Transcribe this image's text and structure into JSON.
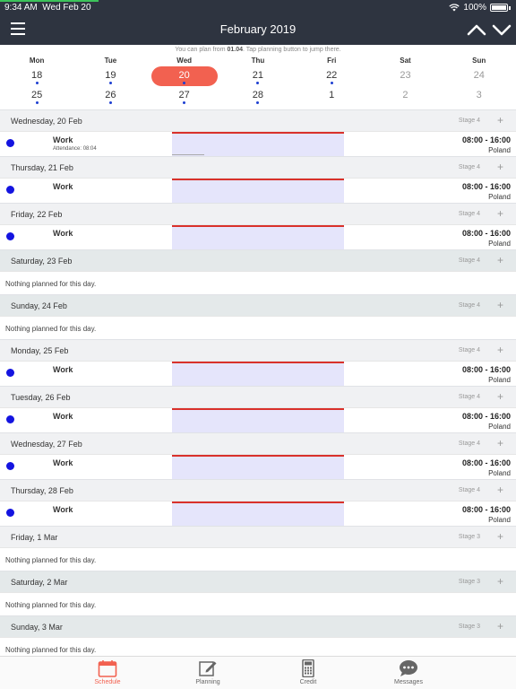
{
  "status_bar": {
    "time": "9:34 AM",
    "date": "Wed Feb 20",
    "battery": "100%"
  },
  "header": {
    "title": "February 2019",
    "menu_icon": "hamburger-icon",
    "prev_icon": "chevron-up-icon",
    "next_icon": "chevron-down-icon"
  },
  "calendar": {
    "hint_prefix": "You can plan from ",
    "hint_date": "01.04",
    "hint_suffix": ". Tap planning button to jump there.",
    "weekdays": [
      "Mon",
      "Tue",
      "Wed",
      "Thu",
      "Fri",
      "Sat",
      "Sun"
    ],
    "week1": [
      "18",
      "19",
      "20",
      "21",
      "22",
      "23",
      "24"
    ],
    "week2": [
      "25",
      "26",
      "27",
      "28",
      "1",
      "2",
      "3"
    ],
    "selected_day": "20",
    "accent_color": "#f26150"
  },
  "days": [
    {
      "label": "Wednesday, 20 Feb",
      "stage": "Stage 4",
      "plus": "+",
      "entry": {
        "title": "Work",
        "subtitle": "Attendance: 08:04",
        "time": "08:00 - 16:00",
        "location": "Poland"
      }
    },
    {
      "label": "Thursday, 21 Feb",
      "stage": "Stage 4",
      "plus": "+",
      "entry": {
        "title": "Work",
        "time": "08:00 - 16:00",
        "location": "Poland"
      }
    },
    {
      "label": "Friday, 22 Feb",
      "stage": "Stage 4",
      "plus": "+",
      "entry": {
        "title": "Work",
        "time": "08:00 - 16:00",
        "location": "Poland"
      }
    },
    {
      "label": "Saturday, 23 Feb",
      "stage": "Stage 4",
      "plus": "+",
      "nothing": "Nothing planned for this day."
    },
    {
      "label": "Sunday, 24 Feb",
      "stage": "Stage 4",
      "plus": "+",
      "nothing": "Nothing planned for this day."
    },
    {
      "label": "Monday, 25 Feb",
      "stage": "Stage 4",
      "plus": "+",
      "entry": {
        "title": "Work",
        "time": "08:00 - 16:00",
        "location": "Poland"
      }
    },
    {
      "label": "Tuesday, 26 Feb",
      "stage": "Stage 4",
      "plus": "+",
      "entry": {
        "title": "Work",
        "time": "08:00 - 16:00",
        "location": "Poland"
      }
    },
    {
      "label": "Wednesday, 27 Feb",
      "stage": "Stage 4",
      "plus": "+",
      "entry": {
        "title": "Work",
        "time": "08:00 - 16:00",
        "location": "Poland"
      }
    },
    {
      "label": "Thursday, 28 Feb",
      "stage": "Stage 4",
      "plus": "+",
      "entry": {
        "title": "Work",
        "time": "08:00 - 16:00",
        "location": "Poland"
      }
    },
    {
      "label": "Friday, 1 Mar",
      "stage": "Stage 3",
      "plus": "+",
      "nothing": "Nothing planned for this day."
    },
    {
      "label": "Saturday, 2 Mar",
      "stage": "Stage 3",
      "plus": "+",
      "nothing": "Nothing planned for this day."
    },
    {
      "label": "Sunday, 3 Mar",
      "stage": "Stage 3",
      "plus": "+",
      "nothing": "Nothing planned for this day."
    }
  ],
  "tabs": [
    {
      "label": "Schedule",
      "icon": "calendar-icon",
      "active": true
    },
    {
      "label": "Planning",
      "icon": "edit-icon",
      "active": false
    },
    {
      "label": "Credit",
      "icon": "calculator-icon",
      "active": false
    },
    {
      "label": "Messages",
      "icon": "chat-bubble-icon",
      "active": false
    }
  ]
}
